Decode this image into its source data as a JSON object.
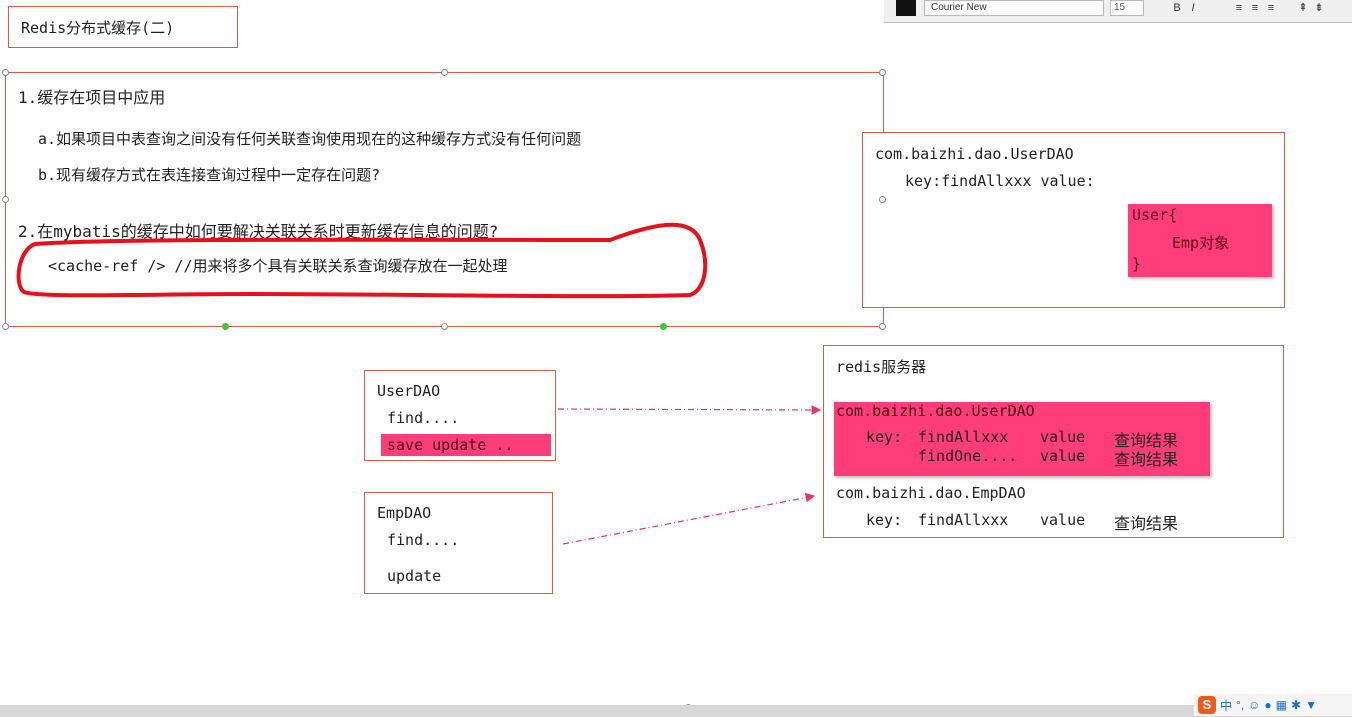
{
  "toolbar": {
    "font_name": "Courier New",
    "font_size": "15"
  },
  "title": "Redis分布式缓存(二)",
  "main": {
    "heading1": "1.缓存在项目中应用",
    "item_a": "a.如果项目中表查询之间没有任何关联查询使用现在的这种缓存方式没有任何问题",
    "item_b": "b.现有缓存方式在表连接查询过程中一定存在问题?",
    "heading2": "2.在mybatis的缓存中如何要解决关联关系时更新缓存信息的问题?",
    "cache_ref": "<cache-ref />  //用来将多个具有关联关系查询缓存放在一起处理"
  },
  "userdao_cache": {
    "namespace": "com.baizhi.dao.UserDAO",
    "entry": "key:findAllxxx  value:",
    "obj_open": "User{",
    "obj_field": "Emp对象",
    "obj_close": "}"
  },
  "userdao_box": {
    "title": "UserDAO",
    "find": "find....",
    "save_update": "save update .."
  },
  "empdao_box": {
    "title": "EmpDAO",
    "find": "find....",
    "update": "update"
  },
  "redis": {
    "title": "redis服务器",
    "ns1": "com.baizhi.dao.UserDAO",
    "ns1_key_label": "key:",
    "ns1_row1_key": "findAllxxx",
    "ns1_row1_value": "value",
    "ns1_row1_result": "查询结果",
    "ns1_row2_key": "findOne....",
    "ns1_row2_value": "value",
    "ns1_row2_result": "查询结果",
    "ns2": "com.baizhi.dao.EmpDAO",
    "ns2_key_label": "key:",
    "ns2_row1_key": "findAllxxx",
    "ns2_row1_value": "value",
    "ns2_row1_result": "查询结果"
  },
  "ime": {
    "lang": "中"
  },
  "colors": {
    "border": "#e05a4a",
    "highlight": "#ff3d7a",
    "annotation_red": "#e8101a",
    "arrow": "#e8306a"
  }
}
